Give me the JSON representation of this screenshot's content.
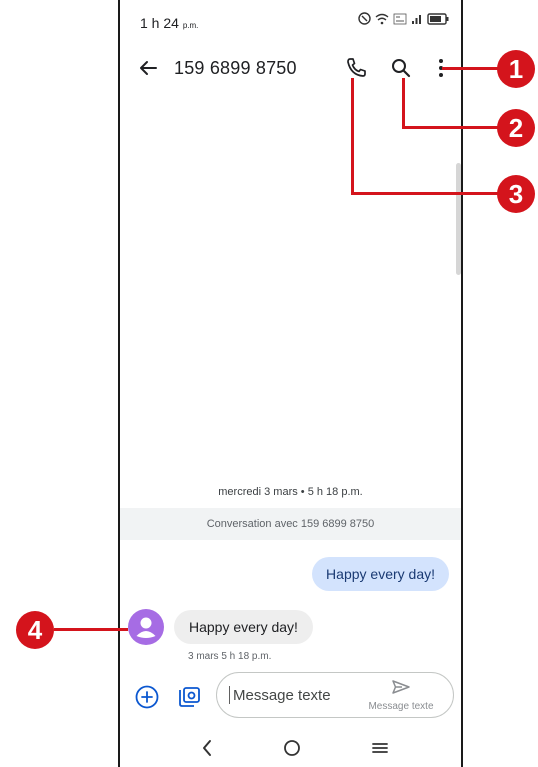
{
  "status_bar": {
    "time": "1 h 24",
    "time_suffix": "p.m."
  },
  "app_bar": {
    "title": "159 6899 8750"
  },
  "conversation": {
    "date_divider": "mercredi 3 mars • 5 h 18 p.m.",
    "banner": "Conversation avec 159 6899 8750",
    "outgoing_message": "Happy every day!",
    "incoming_message": "Happy every day!",
    "incoming_meta": "3 mars 5 h 18 p.m."
  },
  "compose": {
    "placeholder": "Message texte",
    "send_label": "Message texte"
  },
  "callouts": [
    "1",
    "2",
    "3",
    "4"
  ],
  "colors": {
    "callout": "#d4141c",
    "outgoing_bubble": "#d3e3fd",
    "incoming_bubble": "#eeeeee",
    "avatar": "#a66ce4",
    "accent_icon": "#0b57d0"
  }
}
